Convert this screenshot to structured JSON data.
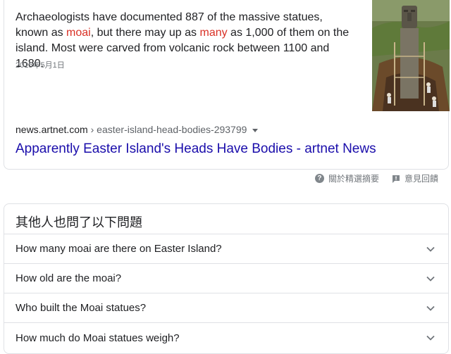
{
  "snippet": {
    "text_part1": "Archaeologists have documented 887 of the massive statues, known as ",
    "highlight1": "moai",
    "text_part2": ", but there may up as ",
    "highlight2": "many",
    "text_part3": " as 1,000 of them on the island. Most were carved from volcanic rock between 1100 and 1680.",
    "date": "2015年5月1日",
    "source_domain": "news.artnet.com",
    "source_path": " › easter-island-head-bodies-293799",
    "title": "Apparently Easter Island's Heads Have Bodies - artnet News"
  },
  "feedback": {
    "about_label": "關於精選摘要",
    "feedback_label": "意見回饋"
  },
  "paa": {
    "header": "其他人也問了以下問題",
    "questions": [
      "How many moai are there on Easter Island?",
      "How old are the moai?",
      "Who built the Moai statues?",
      "How much do Moai statues weigh?"
    ]
  },
  "colors": {
    "link": "#1a0dab",
    "highlight": "#d93025",
    "border": "#dfe1e5"
  }
}
